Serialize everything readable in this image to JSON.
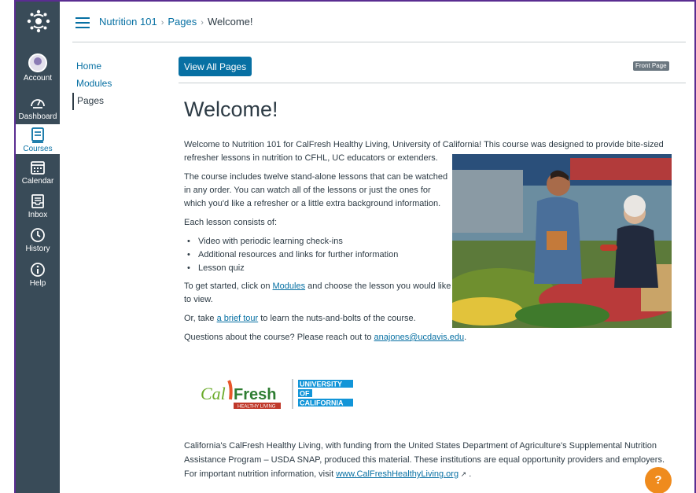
{
  "global_nav": {
    "items": [
      {
        "label": "Account",
        "icon": "avatar"
      },
      {
        "label": "Dashboard",
        "icon": "dashboard-icon"
      },
      {
        "label": "Courses",
        "icon": "courses-icon",
        "active": true
      },
      {
        "label": "Calendar",
        "icon": "calendar-icon"
      },
      {
        "label": "Inbox",
        "icon": "inbox-icon"
      },
      {
        "label": "History",
        "icon": "history-icon"
      },
      {
        "label": "Help",
        "icon": "help-icon"
      }
    ]
  },
  "breadcrumb": {
    "course": "Nutrition 101",
    "section": "Pages",
    "current": "Welcome!"
  },
  "course_nav": {
    "items": [
      {
        "label": "Home"
      },
      {
        "label": "Modules"
      },
      {
        "label": "Pages",
        "active": true
      }
    ]
  },
  "toolbar": {
    "view_all_label": "View All Pages",
    "front_page_badge": "Front Page"
  },
  "page": {
    "title": "Welcome!",
    "intro": "Welcome to Nutrition 101 for CalFresh Healthy Living, University of California! This course was designed to provide bite-sized refresher lessons in nutrition to CFHL, UC educators or extenders.",
    "lessons_para": "The course includes twelve stand-alone lessons that can be watched in any order. You can watch all of the lessons or just the ones for which you'd like a refresher or a little extra background information.",
    "each_lesson": "Each lesson consists of:",
    "list": [
      "Video with periodic learning check-ins",
      "Additional resources and links for further information",
      "Lesson quiz"
    ],
    "get_started_pre": "To get started, click on ",
    "get_started_link": "Modules",
    "get_started_post": " and choose the lesson you would like to view.",
    "tour_pre": "Or, take ",
    "tour_link": "a brief tour",
    "tour_post": " to learn the nuts-and-bolts of the course.",
    "questions_pre": "Questions about the course? Please reach out to ",
    "questions_link": "anajones@ucdavis.edu",
    "questions_post": "."
  },
  "logo": {
    "calfresh_cal": "Cal",
    "calfresh_fresh": "Fresh",
    "calfresh_tag": "HEALTHY LIVING",
    "uc_line1": "UNIVERSITY",
    "uc_line2": "OF",
    "uc_line3": "CALIFORNIA"
  },
  "footer": {
    "text_pre": "California's CalFresh Healthy Living, with funding from the United States Department of Agriculture's Supplemental Nutrition Assistance Program – USDA SNAP, produced this material. These institutions are equal opportunity providers and employers. For important nutrition information, visit ",
    "link": "www.CalFreshHealthyLiving.org",
    "text_post": " ."
  },
  "help_fab": "?",
  "colors": {
    "nav_bg": "#394b58",
    "link": "#0770a3",
    "frame": "#5a2d91",
    "help_fab": "#ef8b1d"
  }
}
